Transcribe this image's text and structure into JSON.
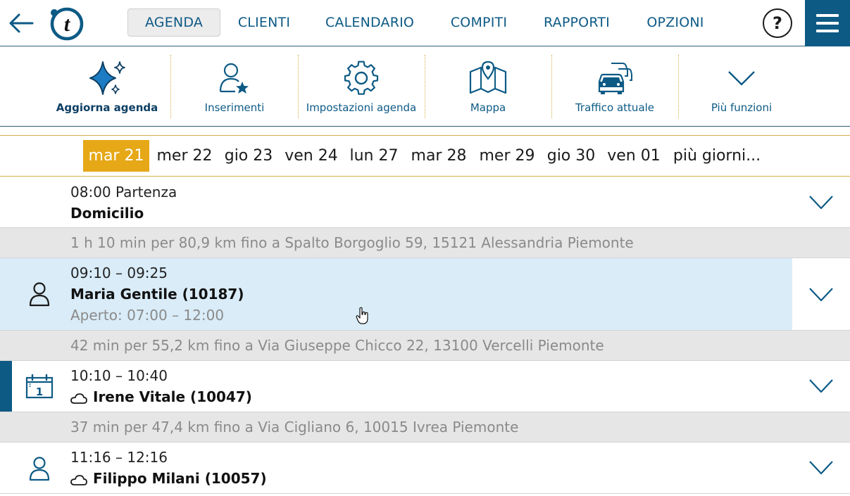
{
  "nav": {
    "tabs": [
      {
        "label": "AGENDA",
        "active": true
      },
      {
        "label": "CLIENTI",
        "active": false
      },
      {
        "label": "CALENDARIO",
        "active": false
      },
      {
        "label": "COMPITI",
        "active": false
      },
      {
        "label": "RAPPORTI",
        "active": false
      },
      {
        "label": "OPZIONI",
        "active": false
      }
    ],
    "help_label": "?"
  },
  "toolbar": {
    "items": [
      {
        "label": "Aggiorna agenda",
        "icon": "sparkle-icon"
      },
      {
        "label": "Inserimenti",
        "icon": "person-star-icon"
      },
      {
        "label": "Impostazioni agenda",
        "icon": "gear-icon"
      },
      {
        "label": "Mappa",
        "icon": "map-icon"
      },
      {
        "label": "Traffico attuale",
        "icon": "traffic-icon"
      },
      {
        "label": "Più funzioni",
        "icon": "chevron-down-icon"
      }
    ]
  },
  "days": [
    {
      "label": "mar 21",
      "active": true
    },
    {
      "label": "mer 22",
      "active": false
    },
    {
      "label": "gio 23",
      "active": false
    },
    {
      "label": "ven 24",
      "active": false
    },
    {
      "label": "lun 27",
      "active": false
    },
    {
      "label": "mar 28",
      "active": false
    },
    {
      "label": "mer 29",
      "active": false
    },
    {
      "label": "gio 30",
      "active": false
    },
    {
      "label": "ven 01",
      "active": false
    },
    {
      "label": "più giorni...",
      "active": false
    }
  ],
  "agenda": {
    "start": {
      "time": "08:00 Partenza",
      "title": "Domicilio"
    },
    "travel": [
      "1 h 10 min per 80,9 km fino a Spalto Borgoglio 59, 15121 Alessandria Piemonte",
      "42 min per 55,2 km fino a Via Giuseppe Chicco 22, 13100 Vercelli Piemonte",
      "37 min per 47,4 km fino a Via Cigliano 6, 10015 Ivrea Piemonte"
    ],
    "appointments": [
      {
        "time": "09:10 – 09:25",
        "title": "Maria Gentile (10187)",
        "detail": "Aperto: 07:00 – 12:00",
        "icon": "person-icon"
      },
      {
        "time": "10:10 – 10:40",
        "title": "Irene Vitale (10047)",
        "icon": "calendar-icon"
      },
      {
        "time": "11:16 – 12:16",
        "title": "Filippo Milani (10057)",
        "icon": "person-icon"
      }
    ]
  },
  "colors": {
    "brand_blue": "#0d5a85",
    "accent_gold": "#e6a817",
    "selected_row": "#d9ecf8",
    "travel_row": "#e6e6e6"
  }
}
